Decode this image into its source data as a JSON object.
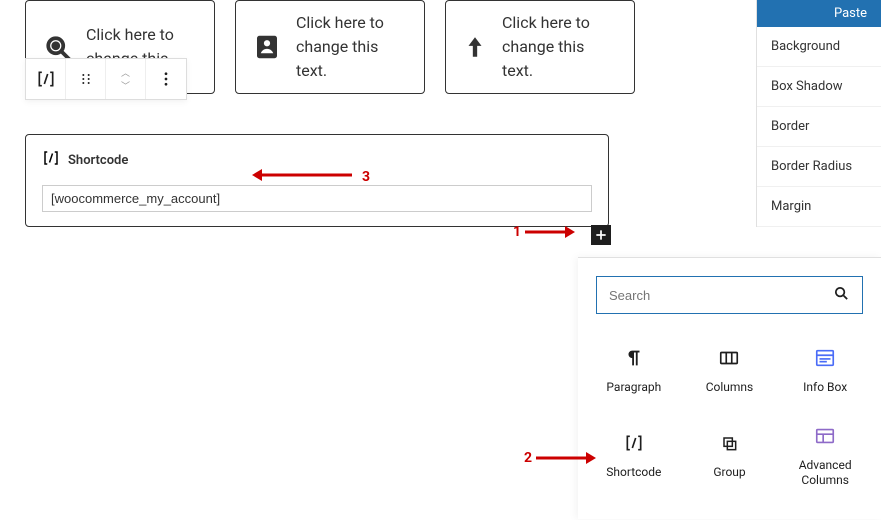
{
  "infoBoxes": [
    {
      "text": "Click here to change this"
    },
    {
      "text": "Click here to change this text."
    },
    {
      "text": "Click here to change this text."
    }
  ],
  "shortcode": {
    "label": "Shortcode",
    "value": "[woocommerce_my_account]"
  },
  "sidebar": {
    "paste": "Paste",
    "items": [
      "Background",
      "Box Shadow",
      "Border",
      "Border Radius",
      "Margin"
    ]
  },
  "inserter": {
    "searchPlaceholder": "Search",
    "blocks": [
      {
        "label": "Paragraph"
      },
      {
        "label": "Columns"
      },
      {
        "label": "Info Box"
      },
      {
        "label": "Shortcode"
      },
      {
        "label": "Group"
      },
      {
        "label": "Advanced Columns"
      }
    ]
  },
  "annotations": {
    "one": "1",
    "two": "2",
    "three": "3"
  }
}
